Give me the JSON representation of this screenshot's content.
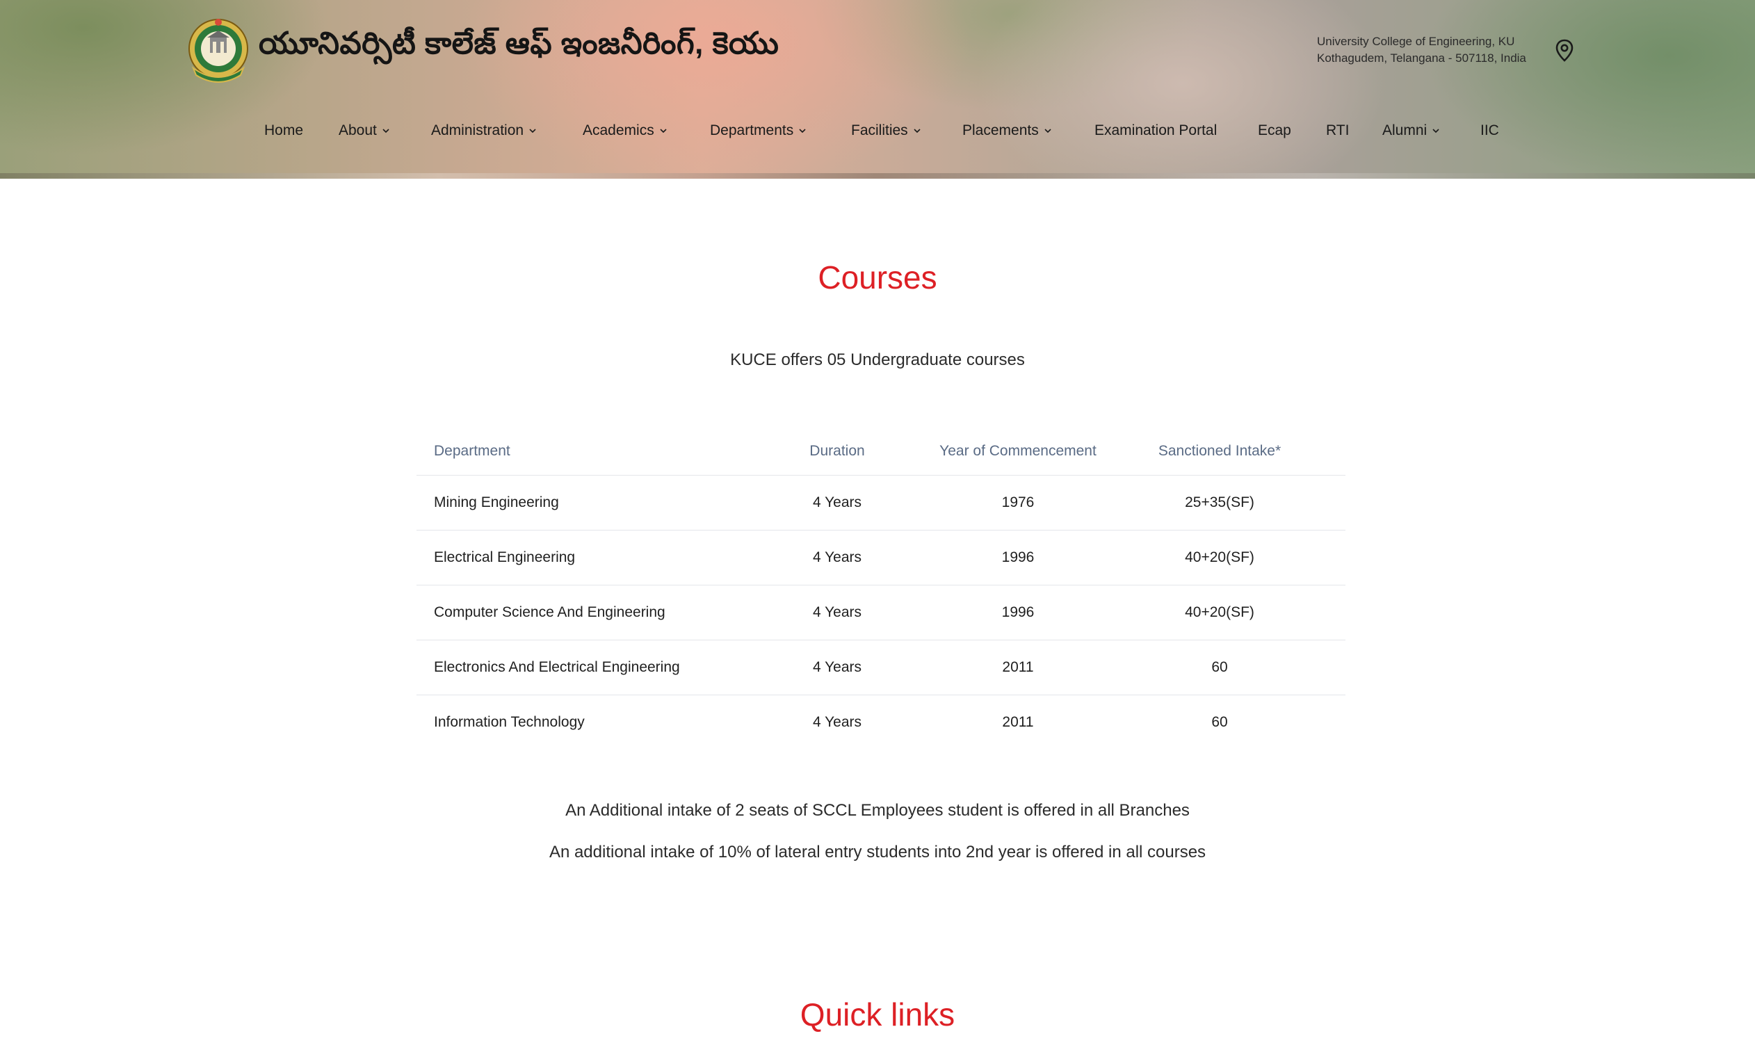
{
  "header": {
    "site_title": "యూనివర్సిటీ కాలేజ్ ఆఫ్ ఇంజనీరింగ్, కెయు",
    "address_line1": "University College of Engineering, KU",
    "address_line2": "Kothagudem, Telangana - 507118, India"
  },
  "nav": {
    "items": [
      {
        "label": "Home",
        "dropdown": false
      },
      {
        "label": "About",
        "dropdown": true
      },
      {
        "label": "Administration",
        "dropdown": true
      },
      {
        "label": "Academics",
        "dropdown": true
      },
      {
        "label": "Departments",
        "dropdown": true
      },
      {
        "label": "Facilities",
        "dropdown": true
      },
      {
        "label": "Placements",
        "dropdown": true
      },
      {
        "label": "Examination Portal",
        "dropdown": false
      },
      {
        "label": "Ecap",
        "dropdown": false
      },
      {
        "label": "RTI",
        "dropdown": false
      },
      {
        "label": "Alumni",
        "dropdown": true
      },
      {
        "label": "IIC",
        "dropdown": false
      }
    ]
  },
  "courses": {
    "title": "Courses",
    "intro": "KUCE offers 05 Undergraduate courses",
    "table": {
      "headers": [
        "Department",
        "Duration",
        "Year of Commencement",
        "Sanctioned Intake*"
      ],
      "rows": [
        [
          "Mining Engineering",
          "4 Years",
          "1976",
          "25+35(SF)"
        ],
        [
          "Electrical Engineering",
          "4 Years",
          "1996",
          "40+20(SF)"
        ],
        [
          "Computer Science And Engineering",
          "4 Years",
          "1996",
          "40+20(SF)"
        ],
        [
          "Electronics And Electrical Engineering",
          "4 Years",
          "2011",
          "60"
        ],
        [
          "Information Technology",
          "4 Years",
          "2011",
          "60"
        ]
      ]
    },
    "note1": "An Additional intake of 2 seats of SCCL Employees student is offered in all Branches",
    "note2": "An additional intake of 10% of lateral entry students into 2nd year is offered in all courses"
  },
  "quick_links": {
    "title": "Quick links"
  },
  "colors": {
    "accent": "#dd2025",
    "table_header_text": "#5a6b85",
    "divider": "#e4e6ea"
  }
}
